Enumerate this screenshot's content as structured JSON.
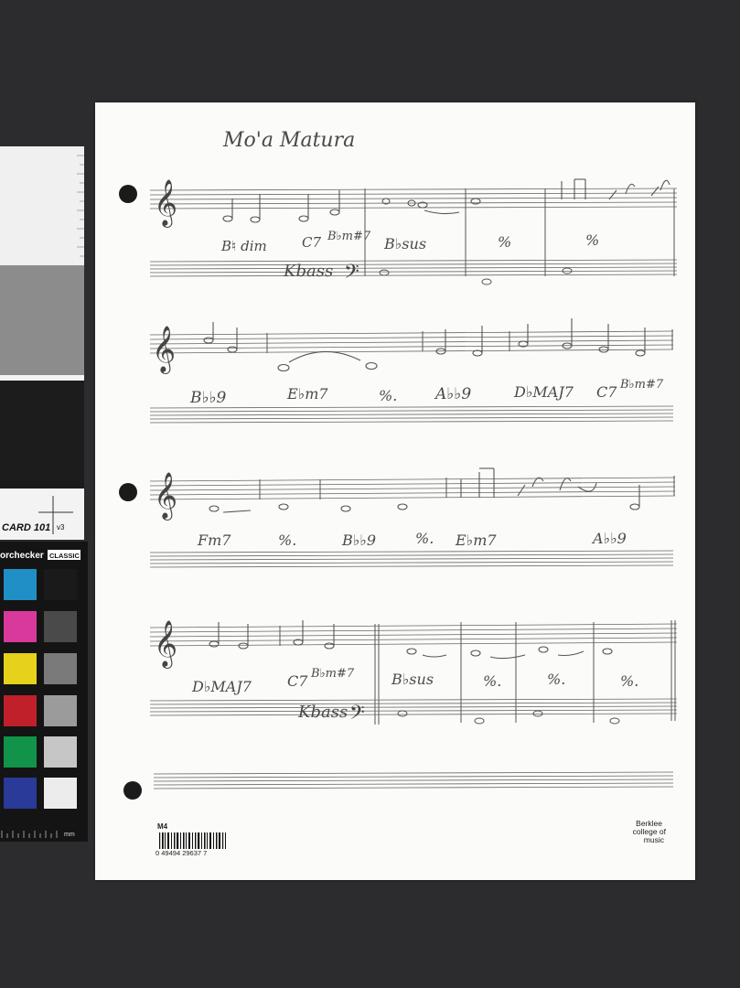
{
  "color_card": {
    "card_label": "CARD 101",
    "version": "v3",
    "brand": "orchecker",
    "edition": "CLASSIC",
    "ruler_unit": "mm",
    "swatches_left": [
      "#1f8fc6",
      "#d9399a",
      "#e6d11b",
      "#c0202a",
      "#11934a",
      "#2a3a98"
    ],
    "swatches_right": [
      "#1a1a1a",
      "#4a4a4a",
      "#7a7a7a",
      "#9b9b9b",
      "#c6c6c6",
      "#ececec"
    ],
    "gray_bands": [
      "#f0f0f0",
      "#8c8c8c",
      "#1c1c1c"
    ]
  },
  "sheet": {
    "title": "Mo'a Matura",
    "systems": [
      {
        "chords": [
          "B♮ dim",
          "C7",
          "B♭m#7",
          "B♭sus",
          "%",
          "%"
        ],
        "bass_label": "Kbass",
        "bass_clef": "𝄢"
      },
      {
        "chords": [
          "B♭♭9",
          "E♭m7",
          "%.",
          "A♭♭9",
          "D♭MAJ7",
          "C7",
          "B♭m#7"
        ]
      },
      {
        "chords": [
          "Fm7",
          "%.",
          "B♭♭9",
          "%.",
          "E♭m7",
          "A♭♭9"
        ]
      },
      {
        "chords": [
          "D♭MAJ7",
          "C7",
          "B♭m#7",
          "B♭sus",
          "%.",
          "%.",
          "%."
        ],
        "bass_label": "Kbass",
        "bass_clef": "𝄢"
      }
    ],
    "treble_clef": "𝄞",
    "footer": {
      "code": "M4",
      "barcode_number": "0 49494 29637 7",
      "publisher_line1": "Berklee",
      "publisher_line2": "college of",
      "publisher_line3": "music"
    }
  }
}
